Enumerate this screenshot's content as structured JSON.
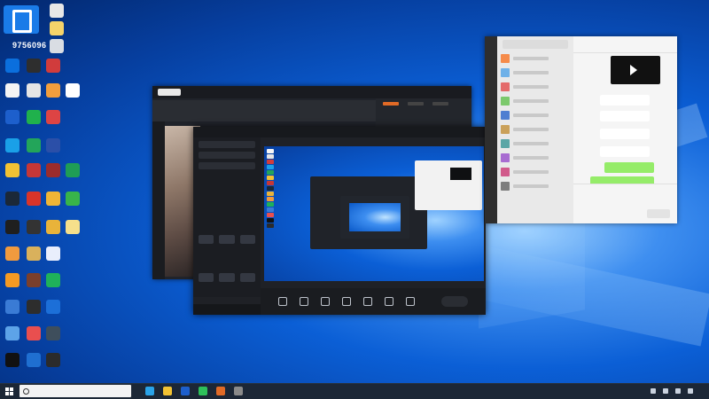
{
  "desktop": {
    "logo_id": "9756096"
  },
  "colors": {
    "accent_blue": "#0b5fd6",
    "taskbar": "#1c2736",
    "brand_orange": "#e16a26",
    "chat_green": "#95ec69"
  },
  "app_window": {
    "brand": "",
    "title": ""
  },
  "player_window": {
    "brand": "",
    "status": ""
  },
  "chat_window": {
    "title": ""
  },
  "taskbar": {
    "search_placeholder": "",
    "time": "",
    "date": ""
  },
  "icons": [
    "windows-logo-icon",
    "search-icon",
    "edge-icon",
    "folder-icon",
    "wechat-icon",
    "store-icon"
  ]
}
